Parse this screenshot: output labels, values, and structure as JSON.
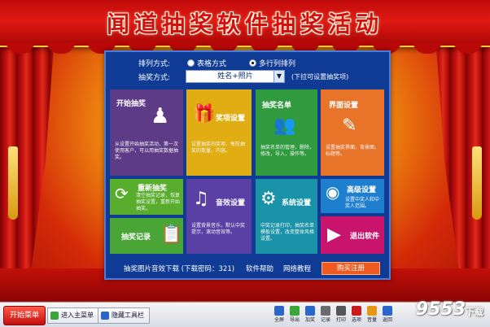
{
  "title": "闻道抽奖软件抽奖活动",
  "options": {
    "arrange_label": "排列方式:",
    "arrange_options": [
      {
        "label": "表格方式",
        "selected": false
      },
      {
        "label": "多行列排列",
        "selected": true
      }
    ],
    "mode_label": "抽奖方式:",
    "mode_value": "姓名+照片",
    "mode_hint": "(下拉可设置抽奖项)"
  },
  "tiles": {
    "start": {
      "title": "开始抽奖",
      "desc": "从设置开始抽奖活动，第一次使用客户，可以用抽奖数据抽奖。",
      "icon": "presenter-icon",
      "color": "#5e3b86"
    },
    "prize": {
      "title": "奖项设置",
      "desc": "设置抽奖的奖项、每轮抽奖的数量，内容。",
      "icon": "gift-icon",
      "color": "#e0ad12"
    },
    "list": {
      "title": "抽奖名单",
      "desc": "抽奖名单的管理，删除，修改，导入，操作等。",
      "icon": "people-icon",
      "color": "#2f9a3e"
    },
    "ui": {
      "title": "界面设置",
      "desc": "设置抽奖界面，背景图，标题等。",
      "icon": "edit-icon",
      "color": "#e8742a"
    },
    "redraw": {
      "title": "重新抽奖",
      "desc": "清空抽奖记录，恢复抽奖设置，重新开始抽奖。",
      "icon": "refresh-icon",
      "color": "#58ad2c"
    },
    "sound": {
      "title": "音效设置",
      "desc": "设置背景音乐，默认中奖提示，滚动音效等。",
      "icon": "music-icon",
      "color": "#5a3fa4"
    },
    "system": {
      "title": "系统设置",
      "desc": "中奖记录打印，抽奖名单模板设置，改变整体风格设置。",
      "icon": "gear-icon",
      "color": "#1a93a8"
    },
    "advanced": {
      "title": "高级设置",
      "desc": "设置中奖人和中奖人范围。",
      "icon": "target-icon",
      "color": "#1f7fcf"
    },
    "record": {
      "title": "抽奖记录",
      "icon": "clipboard-icon",
      "color": "#49a535"
    },
    "exit": {
      "title": "退出软件",
      "icon": "play-icon",
      "color": "#c8146c"
    }
  },
  "bottom_links": {
    "download": "抽奖图片音效下载 (下载密码：321)",
    "help": "软件帮助",
    "tutorial": "网络教程",
    "buy": "购买注册"
  },
  "taskbar": {
    "start": "开始菜单",
    "items": [
      "进入主菜单",
      "隐藏工具栏"
    ],
    "tray": [
      {
        "label": "全屏",
        "icon": "fullscreen-icon",
        "color": "#2a66c9"
      },
      {
        "label": "导出",
        "icon": "export-icon",
        "color": "#3aa53a"
      },
      {
        "label": "加奖",
        "icon": "add-icon",
        "color": "#2a66c9"
      },
      {
        "label": "记录",
        "icon": "record-icon",
        "color": "#6b6b6b"
      },
      {
        "label": "打印",
        "icon": "print-icon",
        "color": "#555"
      },
      {
        "label": "选项",
        "icon": "option-icon",
        "color": "#c91d1d"
      },
      {
        "label": "音量",
        "icon": "volume-icon",
        "color": "#e39a12"
      },
      {
        "label": "返回",
        "icon": "back-icon",
        "color": "#2a66c9"
      }
    ],
    "watermark": "9553",
    "watermark_small": "下载"
  }
}
